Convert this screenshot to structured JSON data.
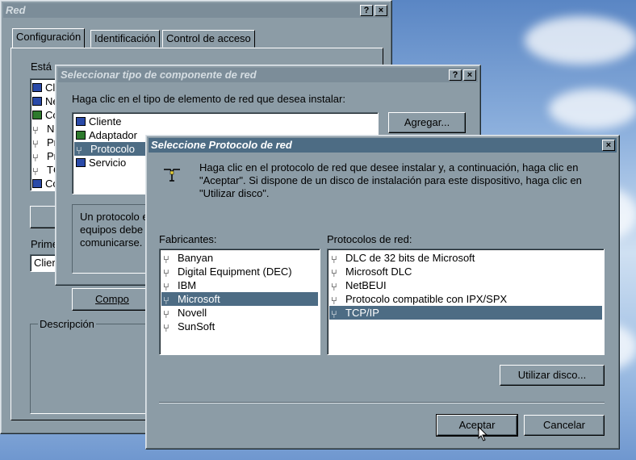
{
  "red_window": {
    "title": "Red",
    "help_label": "?",
    "close_label": "×",
    "tabs": [
      "Configuración",
      "Identificación",
      "Control de acceso"
    ],
    "installed_label": "Está",
    "installed_items": [
      "Cl",
      "Ne",
      "Co",
      "Ne",
      "Pr",
      "Pr",
      "TC",
      "Co"
    ],
    "primary_label": "Prime",
    "primary_value": "Clier",
    "component_button": "Compo",
    "description_label": "Descripción"
  },
  "component_window": {
    "title": "Seleccionar tipo de componente de red",
    "help_label": "?",
    "close_label": "×",
    "prompt": "Haga clic en el tipo de elemento de red que desea instalar:",
    "items": [
      "Cliente",
      "Adaptador",
      "Protocolo",
      "Servicio"
    ],
    "selected_index": 2,
    "add_button": "Agregar...",
    "description_lines": [
      "Un protocolo e",
      "equipos debe",
      "comunicarse."
    ]
  },
  "protocol_window": {
    "title": "Seleccione Protocolo de red",
    "close_label": "×",
    "instructions": "Haga clic en el protocolo de red que desee instalar y, a continuación, haga clic en \"Aceptar\". Si dispone de un disco de instalación para este dispositivo, haga clic en \"Utilizar disco\".",
    "manufacturers_label": "Fabricantes:",
    "manufacturers": [
      "Banyan",
      "Digital Equipment (DEC)",
      "IBM",
      "Microsoft",
      "Novell",
      "SunSoft"
    ],
    "manufacturer_selected": 3,
    "protocols_label": "Protocolos de red:",
    "protocols": [
      "DLC de 32 bits de Microsoft",
      "Microsoft DLC",
      "NetBEUI",
      "Protocolo compatible con IPX/SPX",
      "TCP/IP"
    ],
    "protocol_selected": 4,
    "use_disk_button": "Utilizar disco...",
    "ok_button": "Aceptar",
    "cancel_button": "Cancelar"
  },
  "colors": {
    "selection": "#4d6c84",
    "dialog_face": "#8c9ca6",
    "active_title": "#4d6c84"
  }
}
